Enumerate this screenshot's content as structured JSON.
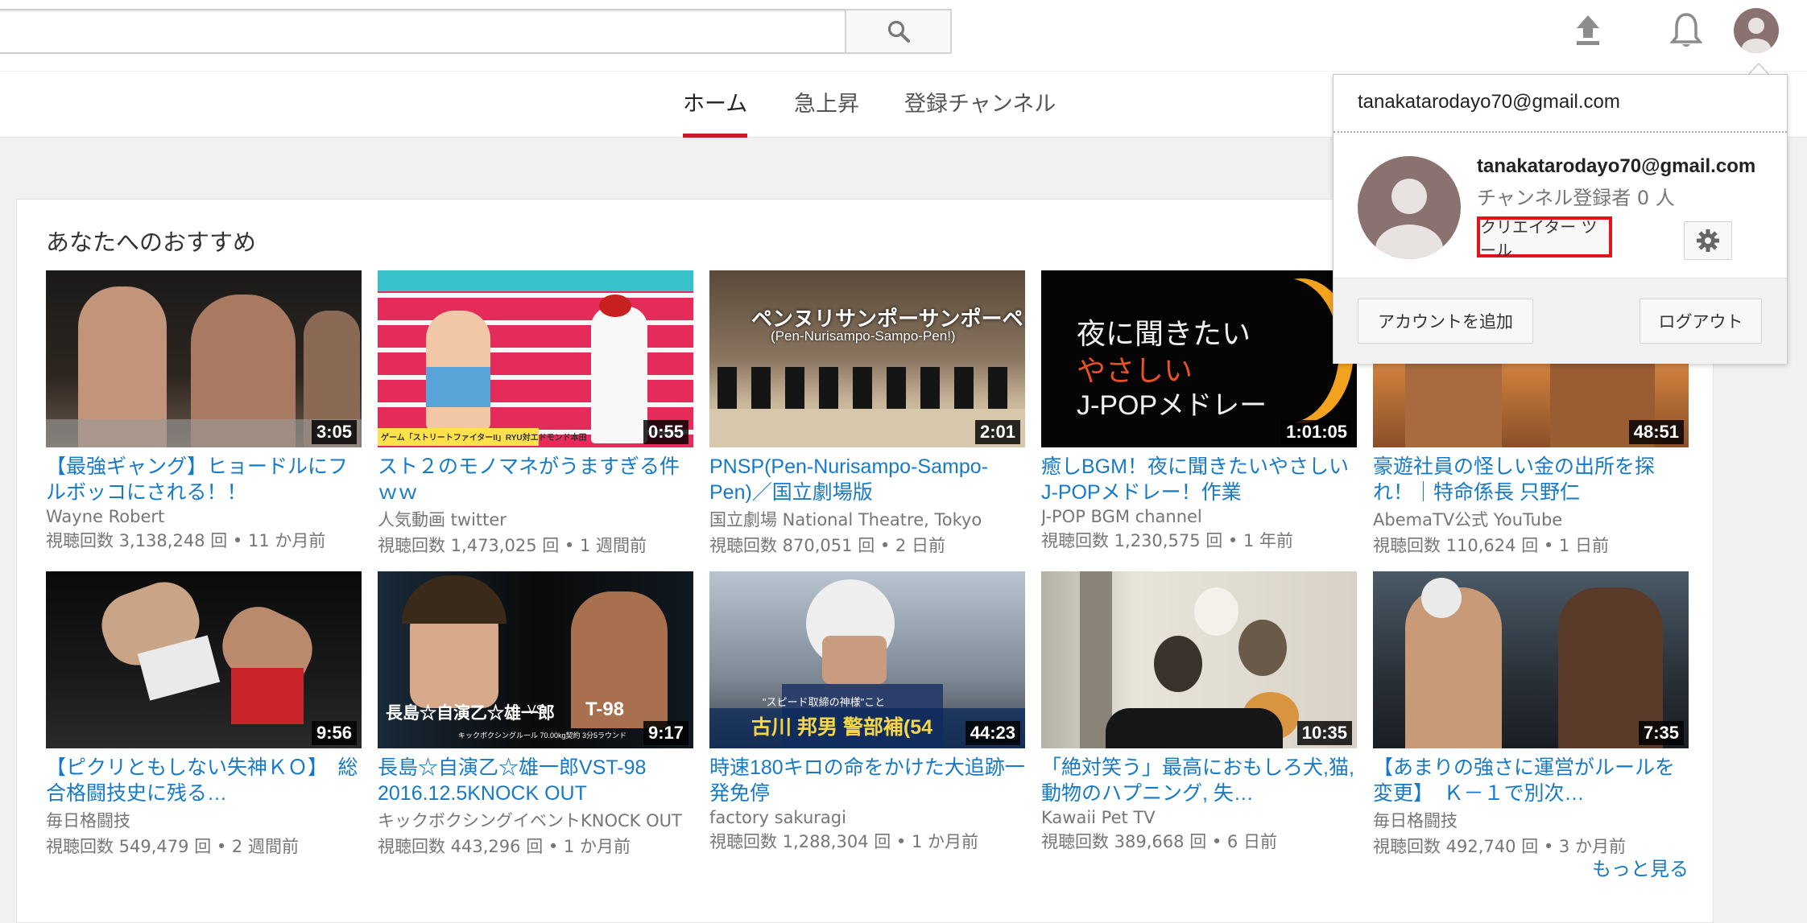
{
  "header": {
    "search": {
      "placeholder": "",
      "value": ""
    },
    "icons": {
      "search": "search-icon",
      "upload": "upload-icon",
      "notifications": "bell-icon",
      "avatar": "avatar"
    }
  },
  "tabs": [
    {
      "label": "ホーム",
      "active": true
    },
    {
      "label": "急上昇",
      "active": false
    },
    {
      "label": "登録チャンネル",
      "active": false
    }
  ],
  "shelf": {
    "title": "あなたへのおすすめ",
    "more_label": "もっと見る",
    "videos": [
      {
        "title": "【最強ギャング】ヒョードルにフルボッコにされる！！",
        "channel": "Wayne Robert",
        "meta": "視聴回数 3,138,248 回 • 11 か月前",
        "duration": "3:05"
      },
      {
        "title": "スト２のモノマネがうますぎる件ｗｗ",
        "channel": "人気動画 twitter",
        "meta": "視聴回数 1,473,025 回 • 1 週間前",
        "duration": "0:55",
        "overlay": "ゲーム「ストリートファイターII」RYU対エドモンド本田"
      },
      {
        "title": "PNSP(Pen-Nurisampo-Sampo-Pen)／国立劇場版",
        "channel": "国立劇場 National Theatre, Tokyo",
        "meta": "視聴回数 870,051 回 • 2 日前",
        "duration": "2:01",
        "overlay": "ペンヌリサンポーサンポーペン!",
        "overlay2": "(Pen-Nurisampo-Sampo-Pen!)"
      },
      {
        "title": "癒しBGM！夜に聞きたいやさしいJ-POPメドレー！作業",
        "channel": "J-POP BGM channel",
        "meta": "視聴回数 1,230,575 回 • 1 年前",
        "duration": "1:01:05",
        "overlay": "夜に聞きたい",
        "overlay2": "やさしい",
        "overlay3": "J-POPメドレー"
      },
      {
        "title": "豪遊社員の怪しい金の出所を探れ！｜特命係長 只野仁",
        "channel": "AbemaTV公式 YouTube",
        "meta": "視聴回数 110,624 回 • 1 日前",
        "duration": "48:51"
      },
      {
        "title": "【ピクリともしない失神ＫＯ】　総合格闘技史に残る…",
        "channel": "毎日格闘技",
        "meta": "視聴回数 549,479 回 • 2 週間前",
        "duration": "9:56"
      },
      {
        "title": "長島☆自演乙☆雄一郎VST-98 2016.12.5KNOCK OUT",
        "channel": "キックボクシングイベントKNOCK OUT",
        "meta": "視聴回数 443,296 回 • 1 か月前",
        "duration": "9:17",
        "overlay": "長島☆自演乙☆雄一郎",
        "overlay2": "VS",
        "overlay3": "T-98",
        "overlay4": "キックボクシングルール 70.00kg契約 3分5ラウンド"
      },
      {
        "title": "時速180キロの命をかけた大追跡一発免停",
        "channel": "factory sakuragi",
        "meta": "視聴回数 1,288,304 回 • 1 か月前",
        "duration": "44:23",
        "overlay": "古川 邦男 警部補(54",
        "overlay2": "\"スピード取締の神様\"こと"
      },
      {
        "title": "「絶対笑う」最高におもしろ犬,猫,動物のハプニング, 失…",
        "channel": "Kawaii Pet TV",
        "meta": "視聴回数 389,668 回 • 6 日前",
        "duration": "10:35"
      },
      {
        "title": "【あまりの強さに運営がルールを変更】　Ｋ－１で別次…",
        "channel": "毎日格闘技",
        "meta": "視聴回数 492,740 回 • 3 か月前",
        "duration": "7:35"
      }
    ]
  },
  "account_popup": {
    "email_header": "tanakatarodayo70@gmail.com",
    "email": "tanakatarodayo70@gmail.com",
    "subscribers": "チャンネル登録者 0 人",
    "creator_tools_label": "クリエイター ツール",
    "add_account_label": "アカウントを追加",
    "logout_label": "ログアウト",
    "settings_icon": "gear-icon"
  },
  "colors": {
    "link_blue": "#167ac6",
    "tab_underline": "#cc181e",
    "highlight_red": "#e0141a",
    "avatar_bg": "#8a7270"
  }
}
